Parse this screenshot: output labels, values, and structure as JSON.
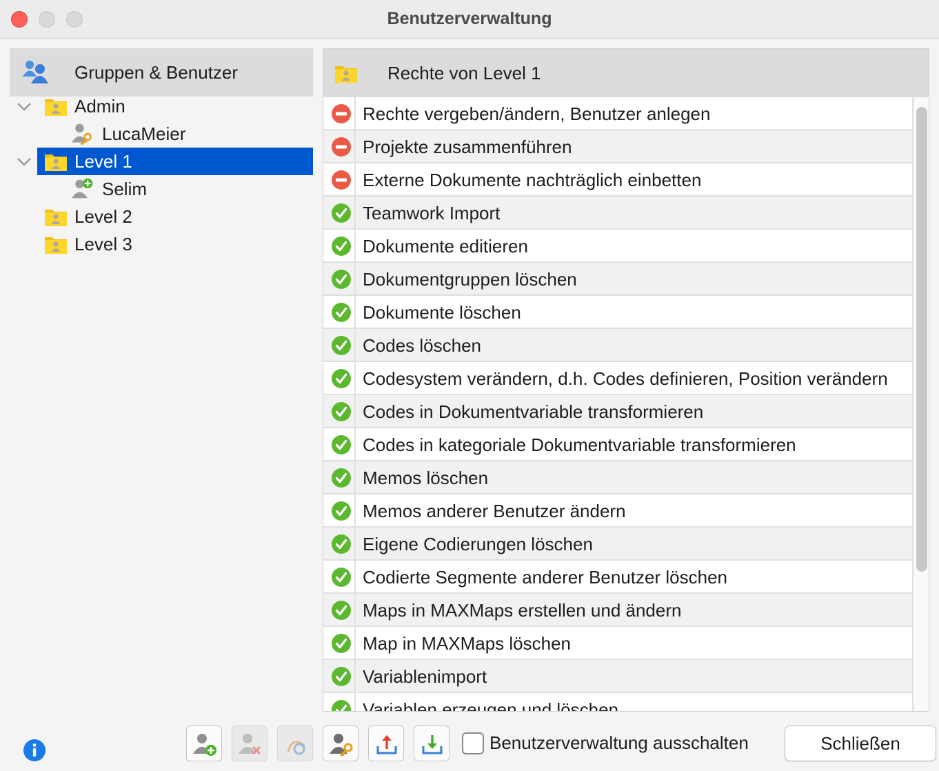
{
  "window": {
    "title": "Benutzerverwaltung"
  },
  "left_panel": {
    "header": "Gruppen & Benutzer",
    "header_icon": "users-icon",
    "tree": [
      {
        "label": "Admin",
        "type": "group",
        "expanded": true,
        "icon": "group-folder-icon"
      },
      {
        "label": "LucaMeier",
        "type": "user",
        "icon": "user-key-icon"
      },
      {
        "label": "Level 1",
        "type": "group",
        "expanded": true,
        "selected": true,
        "icon": "group-folder-icon"
      },
      {
        "label": "Selim",
        "type": "user",
        "icon": "user-add-icon"
      },
      {
        "label": "Level 2",
        "type": "group",
        "icon": "group-folder-icon"
      },
      {
        "label": "Level 3",
        "type": "group",
        "icon": "group-folder-icon"
      }
    ]
  },
  "right_panel": {
    "header": "Rechte von Level 1",
    "header_icon": "group-folder-icon",
    "rights": [
      {
        "label": "Rechte vergeben/ändern, Benutzer anlegen",
        "status": "denied"
      },
      {
        "label": "Projekte zusammenführen",
        "status": "denied"
      },
      {
        "label": "Externe Dokumente nachträglich einbetten",
        "status": "denied"
      },
      {
        "label": "Teamwork Import",
        "status": "allowed"
      },
      {
        "label": "Dokumente editieren",
        "status": "allowed"
      },
      {
        "label": "Dokumentgruppen löschen",
        "status": "allowed"
      },
      {
        "label": "Dokumente löschen",
        "status": "allowed"
      },
      {
        "label": "Codes löschen",
        "status": "allowed"
      },
      {
        "label": "Codesystem verändern, d.h. Codes definieren, Position verändern",
        "status": "allowed"
      },
      {
        "label": "Codes in Dokumentvariable transformieren",
        "status": "allowed"
      },
      {
        "label": "Codes in kategoriale Dokumentvariable transformieren",
        "status": "allowed"
      },
      {
        "label": "Memos löschen",
        "status": "allowed"
      },
      {
        "label": "Memos anderer Benutzer ändern",
        "status": "allowed"
      },
      {
        "label": "Eigene Codierungen löschen",
        "status": "allowed"
      },
      {
        "label": "Codierte Segmente anderer Benutzer löschen",
        "status": "allowed"
      },
      {
        "label": "Maps in MAXMaps erstellen und ändern",
        "status": "allowed"
      },
      {
        "label": "Map in MAXMaps löschen",
        "status": "allowed"
      },
      {
        "label": "Variablenimport",
        "status": "allowed"
      },
      {
        "label": "Variablen erzeugen und löschen",
        "status": "allowed"
      }
    ]
  },
  "toolbar": {
    "buttons": [
      {
        "name": "add-user-button",
        "icon": "user-add-icon",
        "enabled": true
      },
      {
        "name": "delete-user-button",
        "icon": "user-delete-icon",
        "enabled": false
      },
      {
        "name": "reset-button",
        "icon": "refresh-icon",
        "enabled": false
      },
      {
        "name": "set-password-button",
        "icon": "user-key-icon",
        "enabled": true
      },
      {
        "name": "export-button",
        "icon": "export-icon",
        "enabled": true
      },
      {
        "name": "import-button",
        "icon": "import-icon",
        "enabled": true
      }
    ],
    "checkbox_label": "Benutzerverwaltung ausschalten",
    "checkbox_checked": false,
    "close_label": "Schließen",
    "info_icon": "info-icon"
  },
  "colors": {
    "selection": "#0058d0",
    "allowed": "#5cb82e",
    "denied": "#ea5a47",
    "folder": "#f5c518"
  }
}
